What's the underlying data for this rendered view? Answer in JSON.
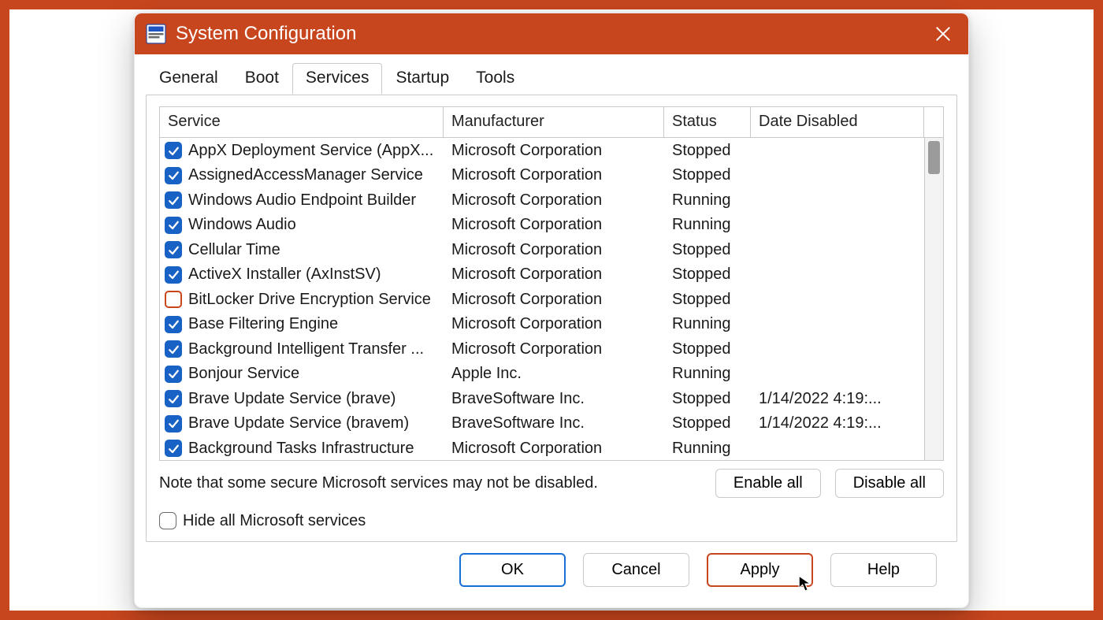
{
  "window": {
    "title": "System Configuration"
  },
  "tabs": [
    "General",
    "Boot",
    "Services",
    "Startup",
    "Tools"
  ],
  "active_tab_index": 2,
  "columns": {
    "service": "Service",
    "manufacturer": "Manufacturer",
    "status": "Status",
    "date_disabled": "Date Disabled"
  },
  "services": [
    {
      "checked": true,
      "name": "AppX Deployment Service (AppX...",
      "manufacturer": "Microsoft Corporation",
      "status": "Stopped",
      "date_disabled": ""
    },
    {
      "checked": true,
      "name": "AssignedAccessManager Service",
      "manufacturer": "Microsoft Corporation",
      "status": "Stopped",
      "date_disabled": ""
    },
    {
      "checked": true,
      "name": "Windows Audio Endpoint Builder",
      "manufacturer": "Microsoft Corporation",
      "status": "Running",
      "date_disabled": ""
    },
    {
      "checked": true,
      "name": "Windows Audio",
      "manufacturer": "Microsoft Corporation",
      "status": "Running",
      "date_disabled": ""
    },
    {
      "checked": true,
      "name": "Cellular Time",
      "manufacturer": "Microsoft Corporation",
      "status": "Stopped",
      "date_disabled": ""
    },
    {
      "checked": true,
      "name": "ActiveX Installer (AxInstSV)",
      "manufacturer": "Microsoft Corporation",
      "status": "Stopped",
      "date_disabled": ""
    },
    {
      "checked": false,
      "name": "BitLocker Drive Encryption Service",
      "manufacturer": "Microsoft Corporation",
      "status": "Stopped",
      "date_disabled": ""
    },
    {
      "checked": true,
      "name": "Base Filtering Engine",
      "manufacturer": "Microsoft Corporation",
      "status": "Running",
      "date_disabled": ""
    },
    {
      "checked": true,
      "name": "Background Intelligent Transfer ...",
      "manufacturer": "Microsoft Corporation",
      "status": "Stopped",
      "date_disabled": ""
    },
    {
      "checked": true,
      "name": "Bonjour Service",
      "manufacturer": "Apple Inc.",
      "status": "Running",
      "date_disabled": ""
    },
    {
      "checked": true,
      "name": "Brave Update Service (brave)",
      "manufacturer": "BraveSoftware Inc.",
      "status": "Stopped",
      "date_disabled": "1/14/2022 4:19:..."
    },
    {
      "checked": true,
      "name": "Brave Update Service (bravem)",
      "manufacturer": "BraveSoftware Inc.",
      "status": "Stopped",
      "date_disabled": "1/14/2022 4:19:..."
    },
    {
      "checked": true,
      "name": "Background Tasks Infrastructure",
      "manufacturer": "Microsoft Corporation",
      "status": "Running",
      "date_disabled": ""
    }
  ],
  "note": "Note that some secure Microsoft services may not be disabled.",
  "enable_all_label": "Enable all",
  "disable_all_label": "Disable all",
  "hide_ms_label": "Hide all Microsoft services",
  "footer": {
    "ok": "OK",
    "cancel": "Cancel",
    "apply": "Apply",
    "help": "Help"
  }
}
